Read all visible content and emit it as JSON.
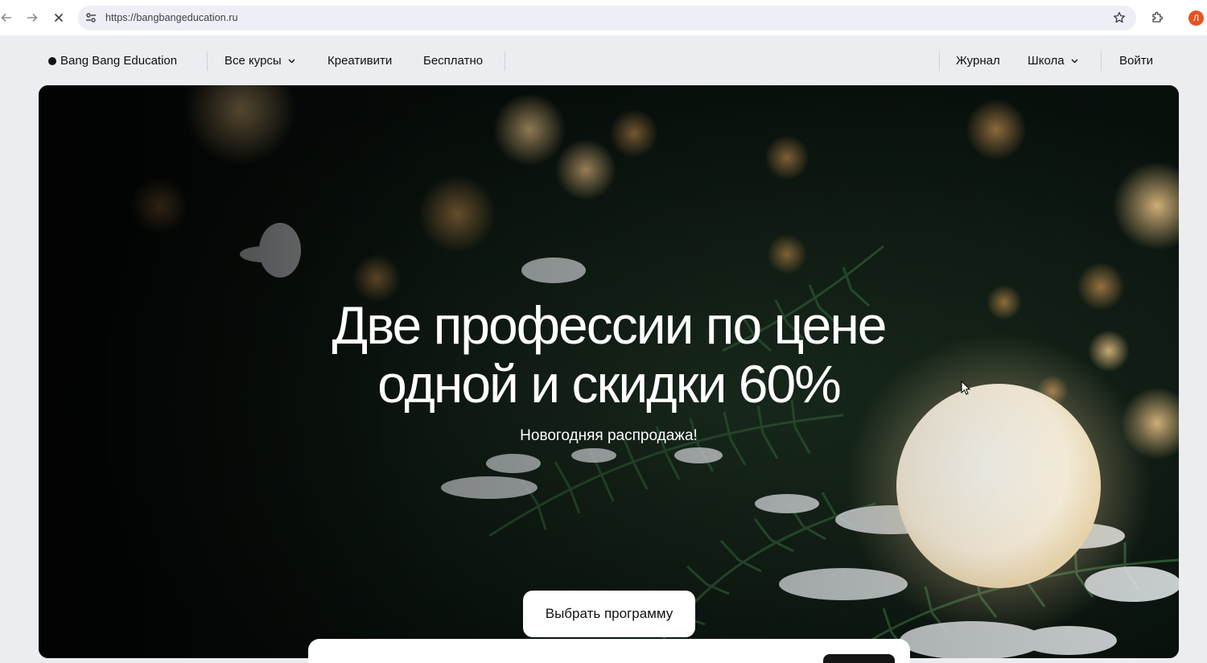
{
  "browser": {
    "url": "https://bangbangeducation.ru",
    "avatar_letter": "Л",
    "back_icon": "arrow-left-icon",
    "forward_icon": "arrow-right-icon",
    "stop_icon": "close-icon",
    "bookmark_icon": "star-icon",
    "extensions_icon": "puzzle-icon"
  },
  "header": {
    "logo": "Bang Bang Education",
    "nav": {
      "courses": "Все курсы",
      "creativity": "Креативити",
      "free": "Бесплатно",
      "journal": "Журнал",
      "school": "Школа",
      "login": "Войти"
    }
  },
  "hero": {
    "title_line1": "Две профессии по цене",
    "title_line2": "одной и скидки 60%",
    "subtitle": "Новогодняя распродажа!",
    "cta": "Выбрать программу"
  },
  "colors": {
    "page_bg": "#ecedf1",
    "avatar": "#e8531f",
    "hero_text": "#ffffff"
  }
}
